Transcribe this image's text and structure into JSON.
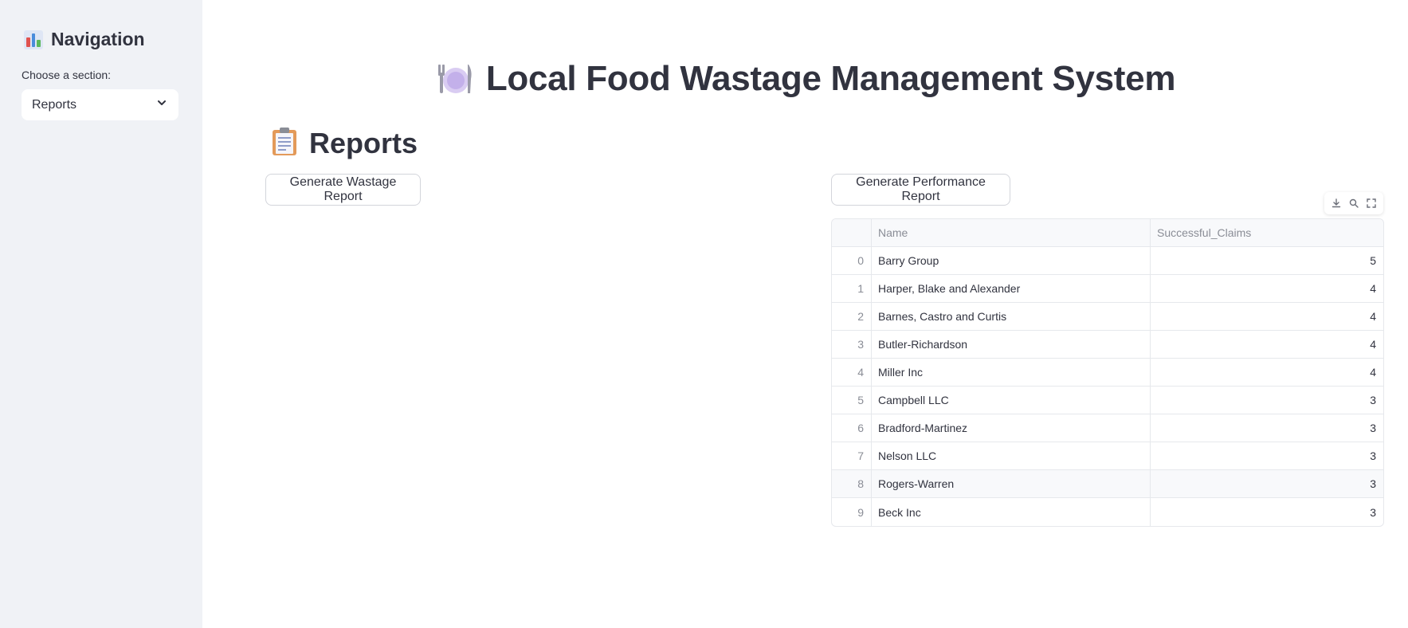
{
  "sidebar": {
    "title": "Navigation",
    "title_icon": "bar-chart-icon",
    "select_label": "Choose a section:",
    "select_value": "Reports"
  },
  "header": {
    "title": "Local Food Wastage Management System",
    "icon": "fork-knife-plate-icon"
  },
  "section": {
    "title": "Reports",
    "icon": "clipboard-icon"
  },
  "buttons": {
    "wastage": "Generate Wastage Report",
    "performance": "Generate Performance Report"
  },
  "table": {
    "columns": [
      "",
      "Name",
      "Successful_Claims"
    ],
    "rows": [
      {
        "index": "0",
        "name": "Barry Group",
        "claims": "5"
      },
      {
        "index": "1",
        "name": "Harper, Blake and Alexander",
        "claims": "4"
      },
      {
        "index": "2",
        "name": "Barnes, Castro and Curtis",
        "claims": "4"
      },
      {
        "index": "3",
        "name": "Butler-Richardson",
        "claims": "4"
      },
      {
        "index": "4",
        "name": "Miller Inc",
        "claims": "4"
      },
      {
        "index": "5",
        "name": "Campbell LLC",
        "claims": "3"
      },
      {
        "index": "6",
        "name": "Bradford-Martinez",
        "claims": "3"
      },
      {
        "index": "7",
        "name": "Nelson LLC",
        "claims": "3"
      },
      {
        "index": "8",
        "name": "Rogers-Warren",
        "claims": "3"
      },
      {
        "index": "9",
        "name": "Beck Inc",
        "claims": "3"
      }
    ]
  },
  "colors": {
    "sidebar_bg": "#f0f2f6",
    "text": "#31333f",
    "muted": "#8a8d96",
    "border": "#e6e8ec"
  }
}
